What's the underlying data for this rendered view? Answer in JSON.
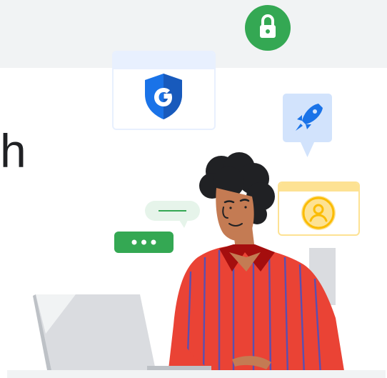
{
  "heading": {
    "visible_fragment": "h"
  },
  "icons": {
    "lock": "lock-icon",
    "shield": "google-shield-icon",
    "rocket": "rocket-icon",
    "chat": "chat-bubble-icon",
    "typing": "typing-dots-icon",
    "user": "user-avatar-icon",
    "laptop": "laptop-icon"
  },
  "colors": {
    "green": "#34a853",
    "blue": "#1a73e8",
    "light_blue": "#d2e3fc",
    "yellow": "#fde293",
    "red": "#ea4335",
    "dark_red": "#c5221f",
    "background": "#f1f3f4"
  }
}
